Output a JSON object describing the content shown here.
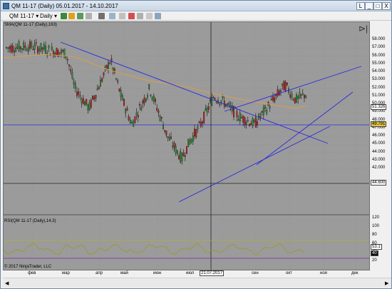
{
  "window": {
    "title": "QM 11-17 (Daily)  05.01.2017 - 14.10.2017",
    "controls": [
      "L",
      "_",
      "□",
      "X"
    ]
  },
  "toolbar": {
    "instrument": "QM 11-17",
    "period": "Daily"
  },
  "chart": {
    "price_indicator_label": "SMA(QM 11-17 (Daily),163)",
    "rsi_indicator_label": "RSI(QM 11-17 (Daily),14,3)",
    "copyright": "© 2017 NinjaTrader, LLC",
    "crosshair_date": "21.07.2017",
    "price_badges": {
      "last": "51.326",
      "line": "49.791",
      "level": "44.600",
      "rsi_a": "53.1",
      "rsi_b": "40"
    },
    "price_ticks": [
      "58.000",
      "57.000",
      "56.000",
      "55.000",
      "54.000",
      "53.000",
      "52.000",
      "51.000",
      "50.000",
      "49.000",
      "48.000",
      "47.000",
      "46.000",
      "45.000",
      "44.000",
      "43.000",
      "42.000"
    ],
    "rsi_ticks": [
      "120",
      "100",
      "80",
      "60",
      "40",
      "20"
    ],
    "x_ticks": [
      "фев",
      "мар",
      "апр",
      "май",
      "июн",
      "июл",
      "авг",
      "сен",
      "окт",
      "ноя",
      "дек"
    ],
    "colors": {
      "background": "#9b9b9b",
      "sma": "#d8a04a",
      "trendline": "#2a2ae0",
      "up_candle": "#2f8f2f",
      "down_candle": "#c02020",
      "rsi": "#9a9a20",
      "rsi_upper": "#b0b030",
      "rsi_lower": "#7a2ab0"
    }
  }
}
